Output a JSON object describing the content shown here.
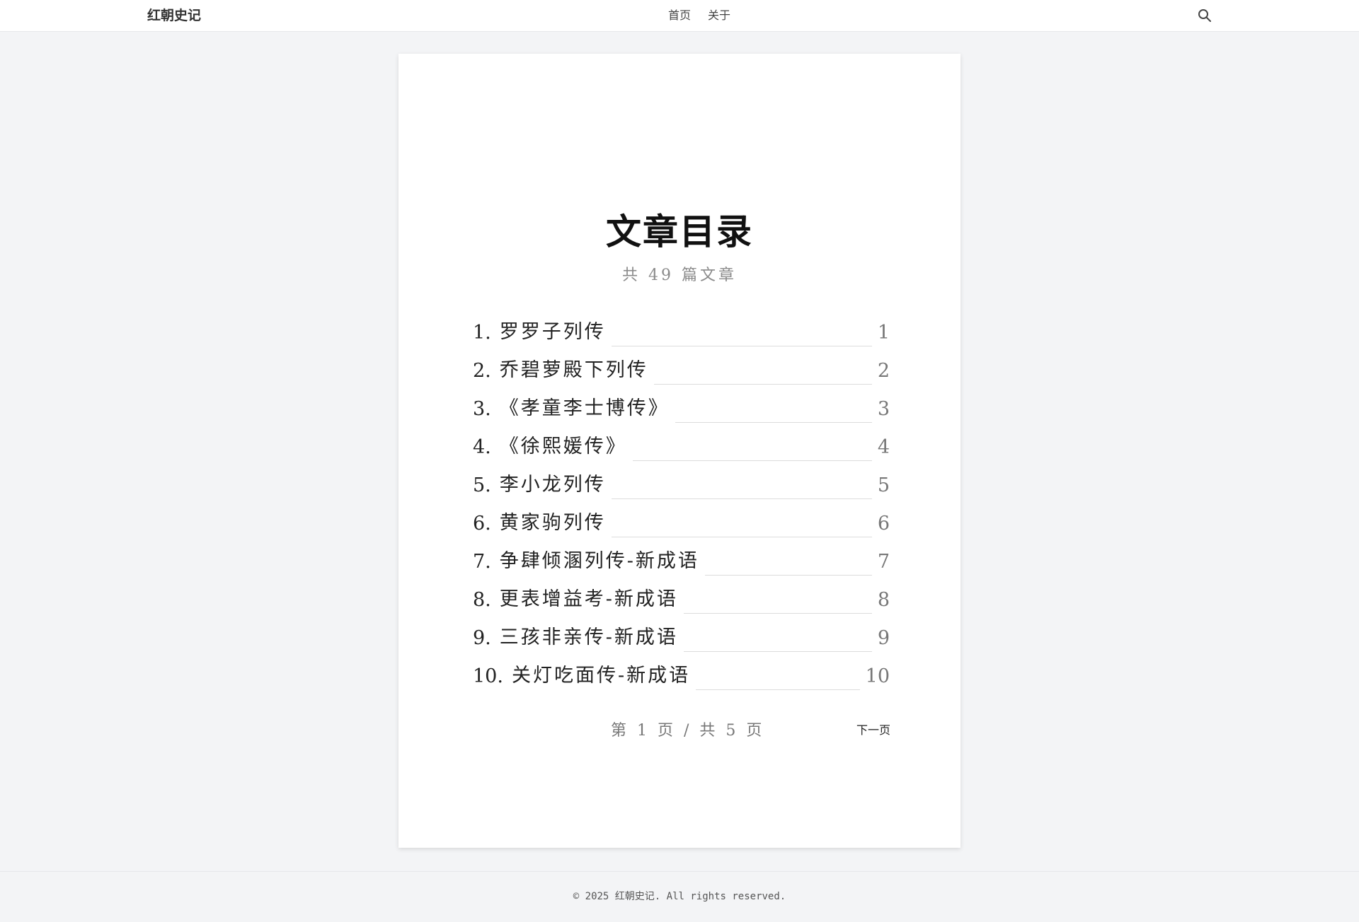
{
  "header": {
    "brand": "红朝史记",
    "nav": [
      "首页",
      "关于"
    ],
    "search_icon": "search-icon"
  },
  "main": {
    "title": "文章目录",
    "subtitle": "共 49 篇文章",
    "toc": [
      {
        "num": "1.",
        "name": "罗罗子列传",
        "page": "1"
      },
      {
        "num": "2.",
        "name": "乔碧萝殿下列传",
        "page": "2"
      },
      {
        "num": "3.",
        "name": "《孝童李士博传》",
        "page": "3"
      },
      {
        "num": "4.",
        "name": "《徐熙媛传》",
        "page": "4"
      },
      {
        "num": "5.",
        "name": "李小龙列传",
        "page": "5"
      },
      {
        "num": "6.",
        "name": "黄家驹列传",
        "page": "6"
      },
      {
        "num": "7.",
        "name": "争肆倾溷列传-新成语",
        "page": "7"
      },
      {
        "num": "8.",
        "name": "更表增益考-新成语",
        "page": "8"
      },
      {
        "num": "9.",
        "name": "三孩非亲传-新成语",
        "page": "9"
      },
      {
        "num": "10.",
        "name": "关灯吃面传-新成语",
        "page": "10"
      }
    ],
    "pager": {
      "info": "第 1 页 / 共 5 页",
      "next": "下一页"
    }
  },
  "footer": {
    "text": "© 2025 红朝史记. All rights reserved."
  }
}
